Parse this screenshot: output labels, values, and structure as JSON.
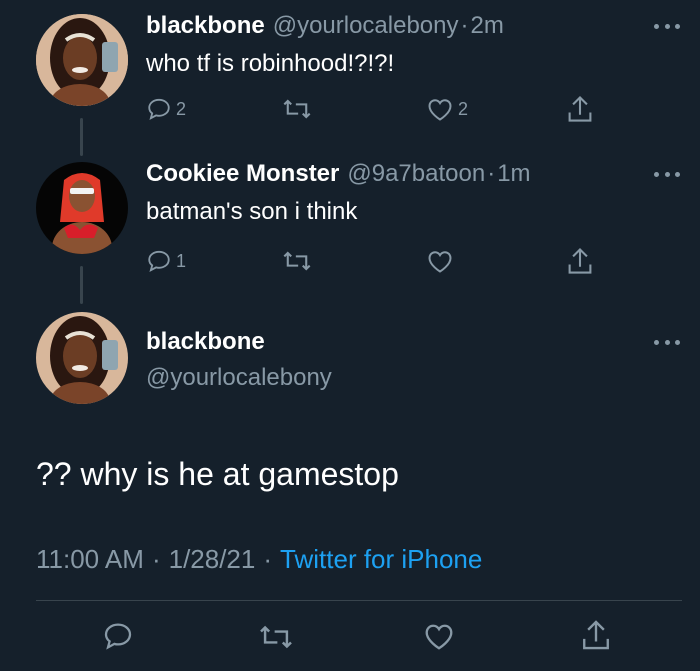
{
  "tweets": [
    {
      "name": "blackbone",
      "handle": "@yourlocalebony",
      "sep": "·",
      "time": "2m",
      "text": "who tf is robinhood!?!?!",
      "reply_count": "2",
      "retweet_count": "",
      "like_count": "2"
    },
    {
      "name": "Cookiee Monster",
      "handle": "@9a7batoon",
      "sep": "·",
      "time": "1m",
      "text": "batman's son i think",
      "reply_count": "1",
      "retweet_count": "",
      "like_count": ""
    }
  ],
  "focused": {
    "name": "blackbone",
    "handle": "@yourlocalebony",
    "text": "?? why is he at gamestop",
    "time": "11:00 AM",
    "sep1": "·",
    "date": "1/28/21",
    "sep2": "·",
    "source": "Twitter for iPhone"
  },
  "icons": {
    "reply": "reply-icon",
    "retweet": "retweet-icon",
    "like": "heart-icon",
    "share": "share-icon",
    "more": "more-icon"
  },
  "colors": {
    "background": "#15202b",
    "secondary_text": "#8899a6",
    "link": "#1da1f2",
    "divider": "#38444d"
  }
}
